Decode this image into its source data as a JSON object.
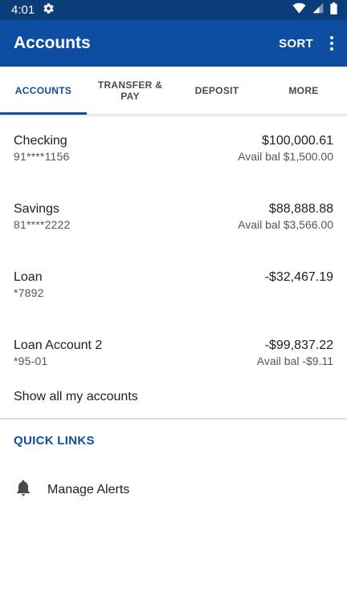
{
  "status_bar": {
    "time": "4:01",
    "icons": [
      "gear-icon",
      "wifi-icon",
      "signal-icon",
      "battery-icon"
    ]
  },
  "app_bar": {
    "title": "Accounts",
    "sort_label": "SORT",
    "background": "#0e4ea0"
  },
  "tabs": [
    {
      "label": "ACCOUNTS",
      "active": true
    },
    {
      "label": "TRANSFER & PAY",
      "active": false
    },
    {
      "label": "DEPOSIT",
      "active": false
    },
    {
      "label": "MORE",
      "active": false
    }
  ],
  "accounts": [
    {
      "name": "Checking",
      "number": "91****1156",
      "balance": "$100,000.61",
      "available": "Avail bal $1,500.00"
    },
    {
      "name": "Savings",
      "number": "81****2222",
      "balance": "$88,888.88",
      "available": "Avail bal $3,566.00"
    },
    {
      "name": "Loan",
      "number": "*7892",
      "balance": "-$32,467.19",
      "available": ""
    },
    {
      "name": "Loan Account 2",
      "number": "*95-01",
      "balance": "-$99,837.22",
      "available": "Avail bal -$9.11"
    }
  ],
  "show_all_label": "Show all my accounts",
  "quick_links": {
    "title": "QUICK LINKS",
    "items": [
      {
        "label": "Manage Alerts",
        "icon": "bell-icon"
      }
    ]
  }
}
